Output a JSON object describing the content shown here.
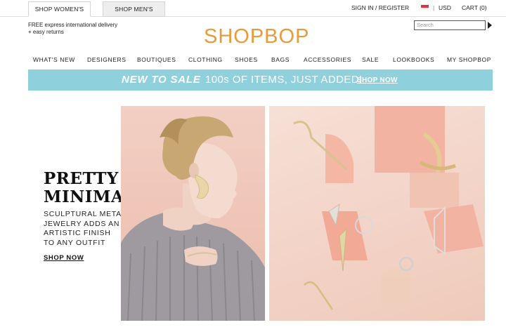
{
  "tabs": {
    "women": "SHOP WOMEN'S",
    "men": "SHOP MEN'S"
  },
  "account": {
    "signin": "SIGN IN / REGISTER",
    "separator": "|",
    "currency": "USD",
    "cart": "CART (0)"
  },
  "promo": {
    "line1": "FREE express international delivery",
    "line2": "+ easy returns"
  },
  "logo": "SHOPBOP",
  "search": {
    "placeholder": "Search"
  },
  "nav": [
    "WHAT'S NEW",
    "DESIGNERS",
    "BOUTIQUES",
    "CLOTHING",
    "SHOES",
    "BAGS",
    "ACCESSORIES",
    "SALE",
    "LOOKBOOKS",
    "MY SHOPBOP"
  ],
  "banner": {
    "lead": "NEW TO SALE",
    "text": "100s OF ITEMS, JUST ADDED!",
    "cta": "SHOP NOW"
  },
  "hero": {
    "headline_line1": "PRETTY",
    "headline_line2": "MINIMAL",
    "sub_line1": "SCULPTURAL METAL",
    "sub_line2": "JEWELRY ADDS AN",
    "sub_line3": "ARTISTIC FINISH",
    "sub_line4": "TO ANY OUTFIT",
    "cta": "SHOP NOW"
  },
  "colors": {
    "logo": "#e89a3c",
    "banner": "#8fd0dd",
    "photo_bg": "#f2cfc3"
  },
  "icons": {
    "flag": "flag-icon",
    "search_submit": "arrow-right-icon"
  }
}
